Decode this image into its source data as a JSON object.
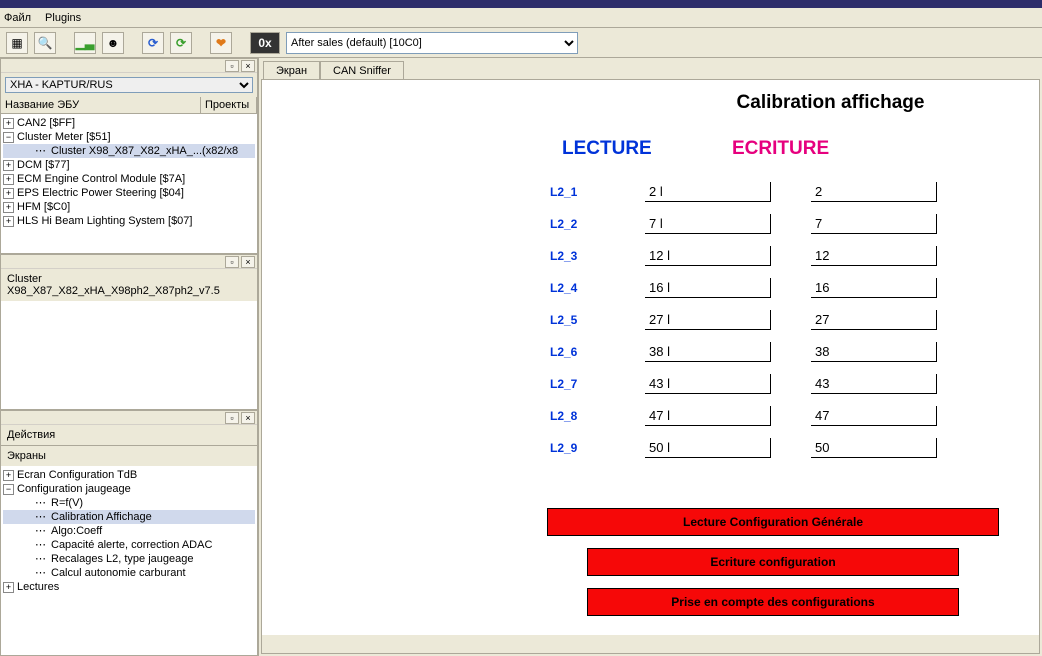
{
  "menu": {
    "file": "Файл",
    "plugins": "Plugins"
  },
  "toolbar": {
    "hex": "0x",
    "dropdown": "After sales (default) [10C0]"
  },
  "leftTop": {
    "vehicleDropdown": "XHA - KAPTUR/RUS",
    "head_name": "Название ЭБУ",
    "head_proj": "Проекты",
    "items": [
      {
        "exp": "+",
        "label": "CAN2 [$FF]"
      },
      {
        "exp": "−",
        "label": "Cluster Meter [$51]"
      },
      {
        "label": "Cluster X98_X87_X82_xHA_...",
        "suffix": "(x82/x8",
        "sel": true,
        "indent": 2
      },
      {
        "exp": "+",
        "label": "DCM [$77]"
      },
      {
        "exp": "+",
        "label": "ECM Engine Control Module [$7A]"
      },
      {
        "exp": "+",
        "label": "EPS Electric Power Steering [$04]"
      },
      {
        "exp": "+",
        "label": "HFM [$C0]"
      },
      {
        "exp": "+",
        "label": "HLS Hi Beam Lighting System [$07]"
      }
    ]
  },
  "leftMid": {
    "label": "Cluster X98_X87_X82_xHA_X98ph2_X87ph2_v7.5"
  },
  "leftBot": {
    "actions": "Действия",
    "screens": "Экраны",
    "items": [
      {
        "exp": "+",
        "label": "Ecran Configuration TdB"
      },
      {
        "exp": "−",
        "label": "Configuration jaugeage"
      },
      {
        "label": "R=f(V)",
        "indent": 2
      },
      {
        "label": "Calibration Affichage",
        "indent": 2,
        "sel": true
      },
      {
        "label": "Algo:Coeff",
        "indent": 2
      },
      {
        "label": "Capacité alerte, correction ADAC",
        "indent": 2
      },
      {
        "label": "Recalages L2, type jaugeage",
        "indent": 2
      },
      {
        "label": "Calcul autonomie carburant",
        "indent": 2
      },
      {
        "exp": "+",
        "label": "Lectures"
      }
    ]
  },
  "tabs": {
    "t1": "Экран",
    "t2": "CAN Sniffer"
  },
  "content": {
    "title": "Calibration affichage",
    "lecture": "LECTURE",
    "ecriture": "ECRITURE",
    "rows": [
      {
        "label": "L2_1",
        "lec": "2 l",
        "ecr": "2"
      },
      {
        "label": "L2_2",
        "lec": "7 l",
        "ecr": "7"
      },
      {
        "label": "L2_3",
        "lec": "12 l",
        "ecr": "12"
      },
      {
        "label": "L2_4",
        "lec": "16 l",
        "ecr": "16"
      },
      {
        "label": "L2_5",
        "lec": "27 l",
        "ecr": "27"
      },
      {
        "label": "L2_6",
        "lec": "38 l",
        "ecr": "38"
      },
      {
        "label": "L2_7",
        "lec": "43 l",
        "ecr": "43"
      },
      {
        "label": "L2_8",
        "lec": "47 l",
        "ecr": "47"
      },
      {
        "label": "L2_9",
        "lec": "50 l",
        "ecr": "50"
      }
    ],
    "btn1": "Lecture Configuration Générale",
    "btn2": "Ecriture configuration",
    "btn3": "Prise en compte des configurations"
  }
}
